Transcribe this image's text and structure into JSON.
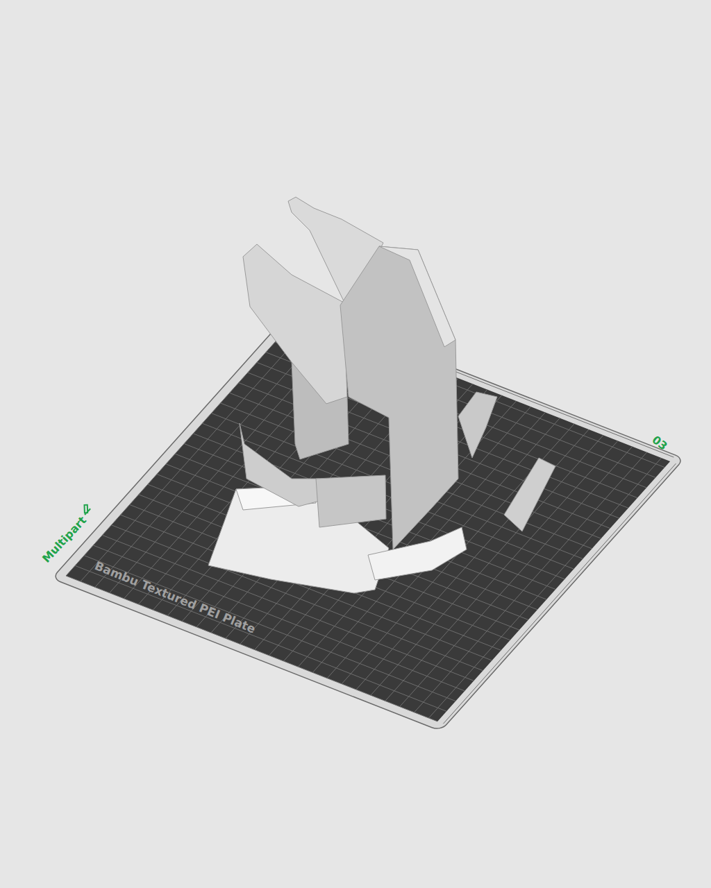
{
  "plate": {
    "label": "Multipart",
    "number": "03",
    "name": "Bambu Textured PEI Plate"
  }
}
